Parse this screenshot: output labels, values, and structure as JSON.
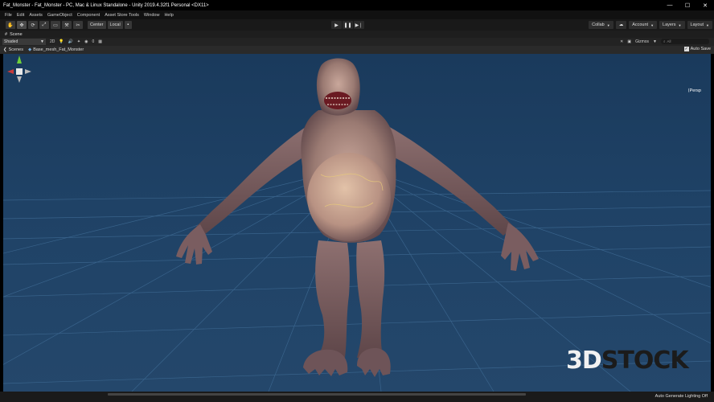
{
  "window": {
    "title": "Fat_Monster - Fat_Monster - PC, Mac & Linux Standalone - Unity 2019.4.32f1 Personal <DX11>",
    "controls": [
      "—",
      "☐",
      "✕"
    ]
  },
  "menu": [
    "File",
    "Edit",
    "Assets",
    "GameObject",
    "Component",
    "Asset Store Tools",
    "Window",
    "Help"
  ],
  "toolbar": {
    "tools": [
      "✋",
      "✥",
      "⟳",
      "⤢",
      "▭",
      "⚒",
      "✂"
    ],
    "pivot": "Center",
    "space": "Local",
    "collab": "Collab",
    "account": "Account",
    "layers": "Layers",
    "layout": "Layout"
  },
  "scene_tab": {
    "label": "Scene"
  },
  "scene_toolbar": {
    "shading": "Shaded",
    "mode_2d": "2D",
    "fx_count": "0",
    "gizmos": "Gizmos",
    "search_placeholder": "All"
  },
  "breadcrumb": {
    "root": "Scenes",
    "object": "Base_mesh_Fat_Monster",
    "auto_save": "Auto Save"
  },
  "viewport": {
    "persp_label": "Persp",
    "watermark_a": "3D",
    "watermark_b": "STOCK"
  },
  "status": {
    "text": "Auto Generate Lighting Off"
  },
  "colors": {
    "sky": "#1f4266",
    "grid": "#3f6b94",
    "skin": "#a88980"
  }
}
